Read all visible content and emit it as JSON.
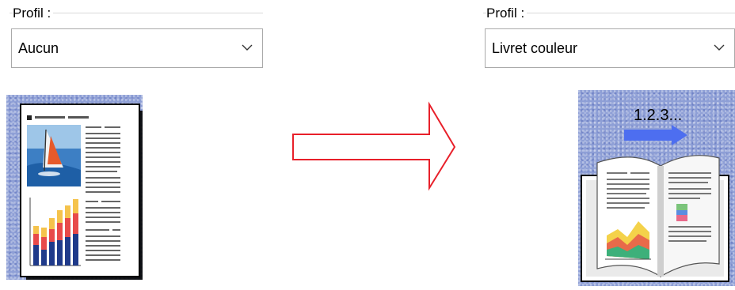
{
  "left_panel": {
    "group_label": "Profil :",
    "select_value": "Aucun",
    "preview_icon": "single-page-document-icon"
  },
  "arrow_icon": "right-arrow-outline-icon",
  "arrow_color": "#e8202a",
  "right_panel": {
    "group_label": "Profil :",
    "select_value": "Livret couleur",
    "preview_icon": "booklet-icon",
    "preview_caption": "1.2.3..."
  }
}
